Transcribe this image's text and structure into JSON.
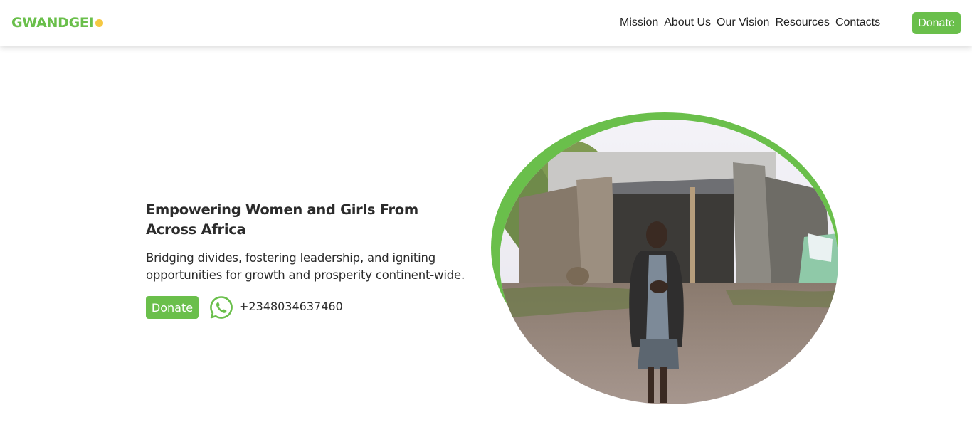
{
  "header": {
    "logo": "GWANDGEI",
    "nav": [
      "Mission",
      "About Us",
      "Our Vision",
      "Resources",
      "Contacts"
    ],
    "donate_label": "Donate"
  },
  "hero": {
    "title": "Empowering Women and Girls From Across Africa",
    "subtitle": "Bridging divides, fostering leadership, and igniting opportunities for growth and prosperity continent-wide.",
    "donate_label": "Donate",
    "phone": "+2348034637460",
    "contact_icon": "whatsapp-icon"
  },
  "colors": {
    "brand_green": "#6abf4b",
    "accent_yellow": "#f5c842",
    "text": "#2b2b2b"
  }
}
